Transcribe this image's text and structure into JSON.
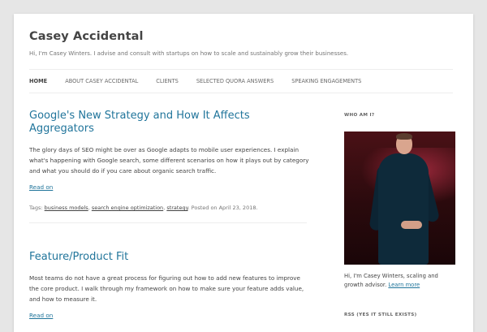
{
  "site": {
    "title": "Casey Accidental",
    "description": "Hi, I'm Casey Winters. I advise and consult with startups on how to scale and sustainably grow their businesses."
  },
  "nav": {
    "items": [
      "HOME",
      "ABOUT CASEY ACCIDENTAL",
      "CLIENTS",
      "SELECTED QUORA ANSWERS",
      "SPEAKING ENGAGEMENTS"
    ]
  },
  "posts": [
    {
      "title": "Google's New Strategy and How It Affects Aggregators",
      "excerpt": "The glory days of SEO might be over as Google adapts to mobile user experiences. I explain what's happening with Google search, some different scenarios on how it plays out by category and what you should do if you care about organic search traffic.",
      "read_on": "Read on",
      "meta": {
        "tags_prefix": "Tags:",
        "tags": [
          "business models",
          "search engine optimization",
          "strategy"
        ],
        "posted": "Posted on April 23, 2018."
      }
    },
    {
      "title": "Feature/Product Fit",
      "excerpt": "Most teams do not have a great process for figuring out how to add new features to improve the core product. I walk through my framework on how to make sure your feature adds value, and how to measure it.",
      "read_on": "Read on"
    }
  ],
  "sidebar": {
    "who_title": "WHO AM I?",
    "who_text": "Hi, I'm Casey Winters, scaling and growth advisor.",
    "learn_more": "Learn more",
    "rss_title": "RSS (YES IT STILL EXISTS)"
  },
  "colors": {
    "link": "#21759b",
    "text": "#444444",
    "background": "#e6e6e6"
  }
}
